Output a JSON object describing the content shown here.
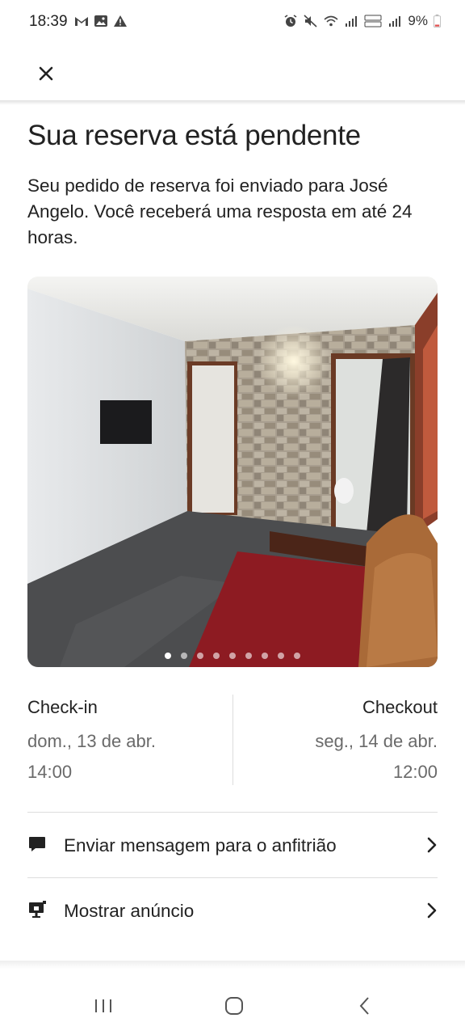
{
  "status_bar": {
    "time": "18:39",
    "battery": "9%",
    "left_icons": [
      "gmail-icon",
      "gallery-icon",
      "warning-icon"
    ],
    "right_icons": [
      "alarm-icon",
      "mute-icon",
      "wifi-icon",
      "signal-icon",
      "volte-icon",
      "signal-icon",
      "battery-icon"
    ]
  },
  "header": {
    "close_icon": "close-icon"
  },
  "main": {
    "title": "Sua reserva está pendente",
    "subtitle": "Seu pedido de reserva foi enviado para José Angelo. Você receberá uma resposta em até 24 horas.",
    "photo": {
      "description_icon": "listing-photo",
      "dot_count": 9,
      "active_index": 0
    }
  },
  "dates": {
    "checkin": {
      "label": "Check-in",
      "day": "dom., 13 de abr.",
      "time": "14:00"
    },
    "checkout": {
      "label": "Checkout",
      "day": "seg., 14 de abr.",
      "time": "12:00"
    }
  },
  "actions": [
    {
      "label": "Enviar mensagem para o anfitrião",
      "icon": "message-icon"
    },
    {
      "label": "Mostrar anúncio",
      "icon": "listing-icon"
    }
  ],
  "nav_bar": {
    "buttons": [
      "recent-apps-icon",
      "home-icon",
      "back-icon"
    ]
  },
  "colors": {
    "text_primary": "#222222",
    "text_secondary": "#6a6a6a",
    "divider": "#dddddd"
  }
}
